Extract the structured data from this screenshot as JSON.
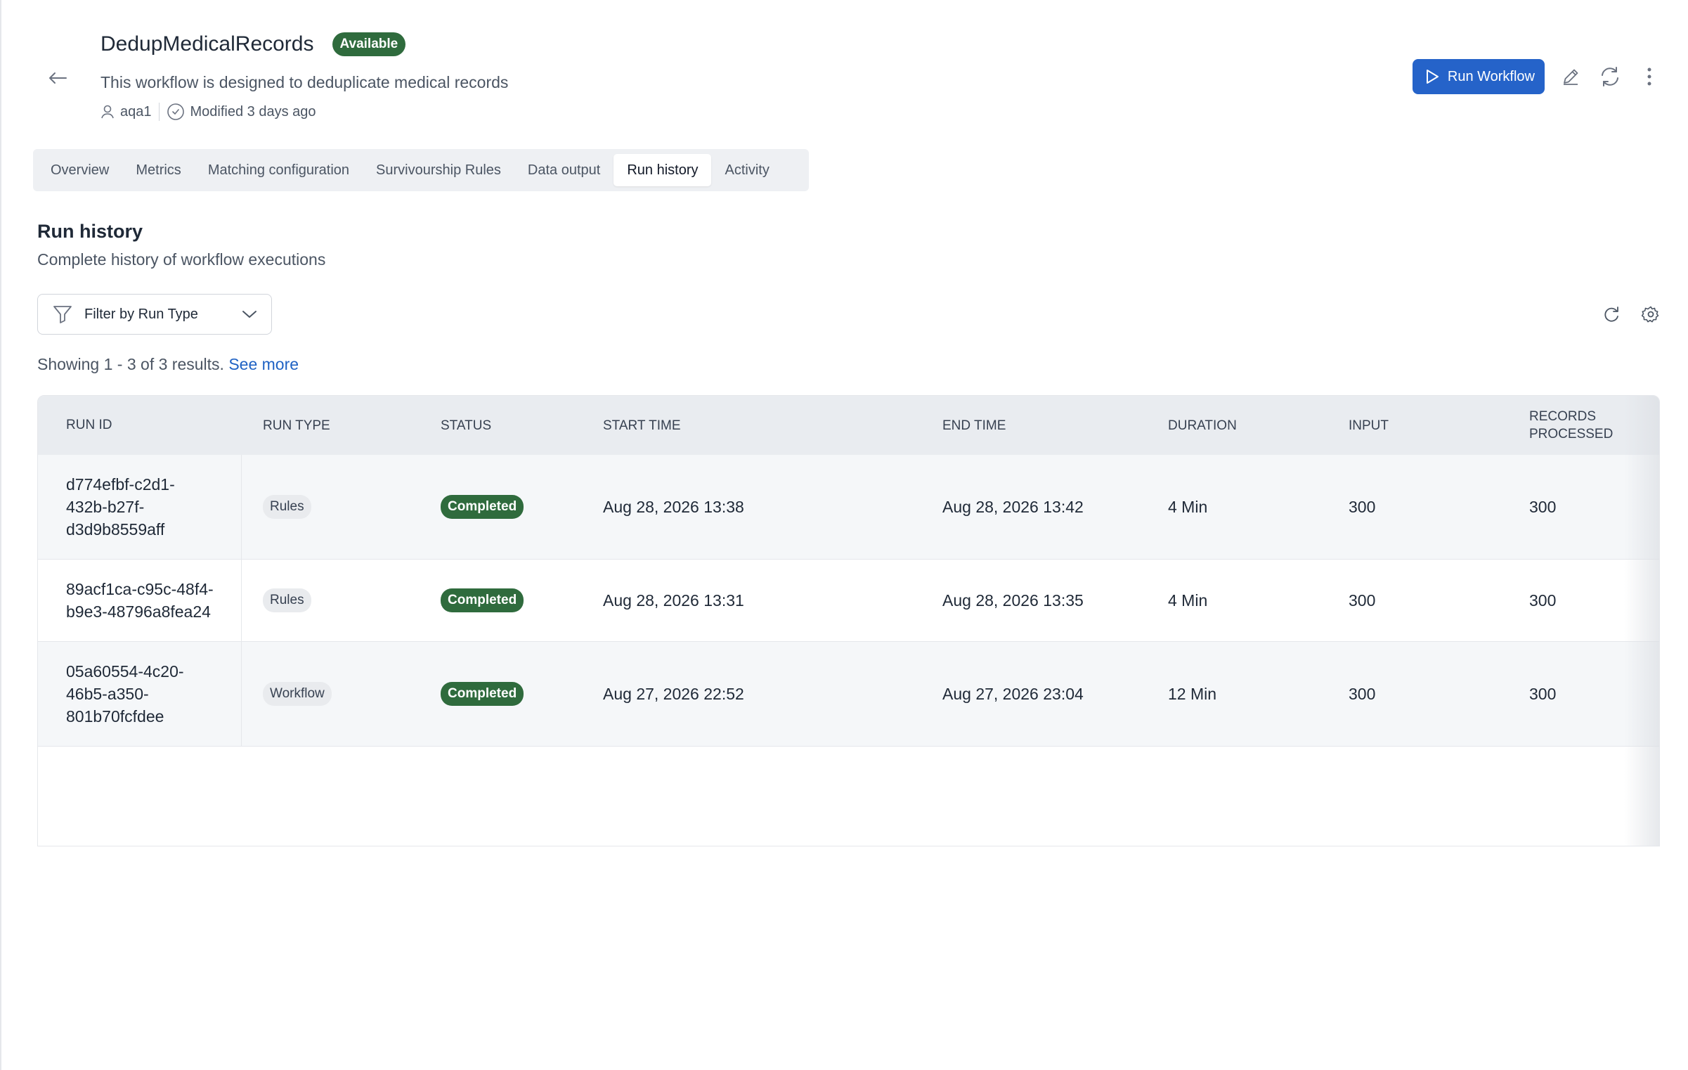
{
  "header": {
    "title": "DedupMedicalRecords",
    "status_badge": "Available",
    "description": "This workflow is designed to deduplicate medical records",
    "owner": "aqa1",
    "modified": "Modified 3 days ago",
    "run_button_label": "Run Workflow"
  },
  "tabs": [
    {
      "label": "Overview"
    },
    {
      "label": "Metrics"
    },
    {
      "label": "Matching configuration"
    },
    {
      "label": "Survivourship Rules"
    },
    {
      "label": "Data output"
    },
    {
      "label": "Run history",
      "active": true
    },
    {
      "label": "Activity"
    }
  ],
  "section": {
    "title": "Run history",
    "subtitle": "Complete history of workflow executions"
  },
  "filter": {
    "label": "Filter by Run Type"
  },
  "results": {
    "showing": "Showing 1 - 3 of 3 results.",
    "see_more": "See more"
  },
  "table": {
    "columns": [
      "RUN ID",
      "RUN TYPE",
      "STATUS",
      "START TIME",
      "END TIME",
      "DURATION",
      "INPUT",
      "RECORDS PROCESSED"
    ],
    "rows": [
      {
        "run_id_lines": [
          "d774efbf-c2d1-",
          "432b-b27f-",
          "d3d9b8559aff"
        ],
        "run_type": "Rules",
        "status": "Completed",
        "start": "Aug 28, 2026 13:38",
        "end": "Aug 28, 2026 13:42",
        "duration": "4 Min",
        "input": "300",
        "processed": "300"
      },
      {
        "run_id_lines": [
          "89acf1ca-c95c-48f4-",
          "b9e3-48796a8fea24"
        ],
        "run_type": "Rules",
        "status": "Completed",
        "start": "Aug 28, 2026 13:31",
        "end": "Aug 28, 2026 13:35",
        "duration": "4 Min",
        "input": "300",
        "processed": "300"
      },
      {
        "run_id_lines": [
          "05a60554-4c20-",
          "46b5-a350-",
          "801b70fcfdee"
        ],
        "run_type": "Workflow",
        "status": "Completed",
        "start": "Aug 27, 2026 22:52",
        "end": "Aug 27, 2026 23:04",
        "duration": "12 Min",
        "input": "300",
        "processed": "300"
      }
    ]
  },
  "colors": {
    "accent": "#2563c9",
    "status_green": "#2f6b3d",
    "link": "#1f62c4"
  },
  "icons": [
    "arrow-left-icon",
    "user-icon",
    "clock-icon",
    "play-icon",
    "pencil-icon",
    "refresh-icon",
    "more-vertical-icon",
    "filter-icon",
    "chevron-down-icon",
    "reload-icon",
    "settings-icon"
  ]
}
